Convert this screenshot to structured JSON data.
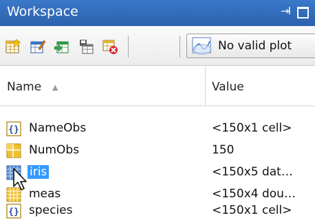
{
  "window": {
    "title": "Workspace",
    "undock_icon": "undock-arrow-icon",
    "maximize_icon": "maximize-icon"
  },
  "toolbar": {
    "icons": [
      "new-variable-icon",
      "open-variable-icon",
      "import-data-icon",
      "save-workspace-icon",
      "delete-variable-icon"
    ],
    "plot_button_label": "No valid plot"
  },
  "table": {
    "columns": {
      "name": "Name",
      "value": "Value"
    },
    "rows": [
      {
        "name": "NameObs",
        "value": "<150x1 cell>",
        "icon": "cell-array-icon"
      },
      {
        "name": "NumObs",
        "value": "150",
        "icon": "scalar-grid-icon"
      },
      {
        "name": "iris",
        "value": "<150x5 dat…",
        "icon": "dataset-icon",
        "selected": true
      },
      {
        "name": "meas",
        "value": "<150x4 dou…",
        "icon": "matrix-icon"
      },
      {
        "name": "species",
        "value": "<150x1 cell>",
        "icon": "cell-array-icon"
      }
    ]
  },
  "colors": {
    "titlebar": "#2f6cb8",
    "selection": "#3399ff"
  }
}
